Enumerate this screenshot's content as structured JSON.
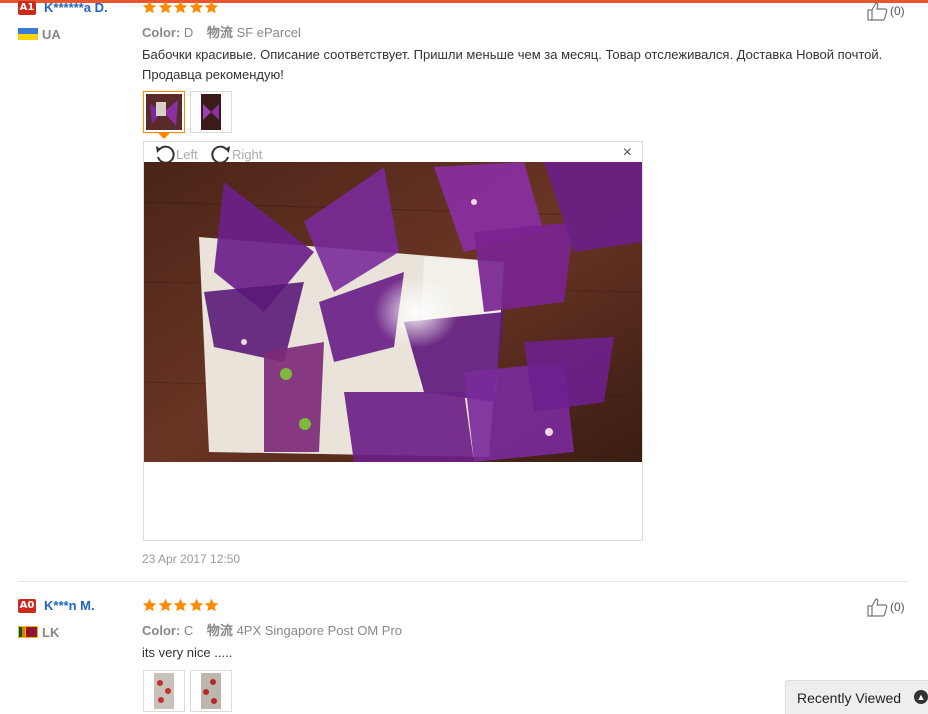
{
  "reviews": [
    {
      "badge": "A1",
      "badge_color": "#cc2a1a",
      "username": "K******a D.",
      "country": "UA",
      "rating": 5,
      "color_label": "Color:",
      "color_value": "D",
      "shipping_label": "物流",
      "shipping_value": "SF eParcel",
      "text": "Бабочки красивые. Описание соответствует. Пришли меньше чем за месяц. Товар отслеживался. Доставка Новой почтой. Продавца рекомендую!",
      "helpful": "(0)",
      "date": "23 Apr 2017 12:50"
    },
    {
      "badge": "A0",
      "badge_color": "#cc2a1a",
      "username": "K***n M.",
      "country": "LK",
      "rating": 5,
      "color_label": "Color:",
      "color_value": "C",
      "shipping_label": "物流",
      "shipping_value": "4PX Singapore Post OM Pro",
      "text": "its very nice .....",
      "helpful": "(0)"
    }
  ],
  "viewer": {
    "rotate_left": "Left",
    "rotate_right": "Right",
    "close": "×"
  },
  "recently_viewed": "Recently Viewed",
  "colors": {
    "link": "#1e64c8",
    "star": "#ff8a00",
    "accent": "#e8552e"
  }
}
